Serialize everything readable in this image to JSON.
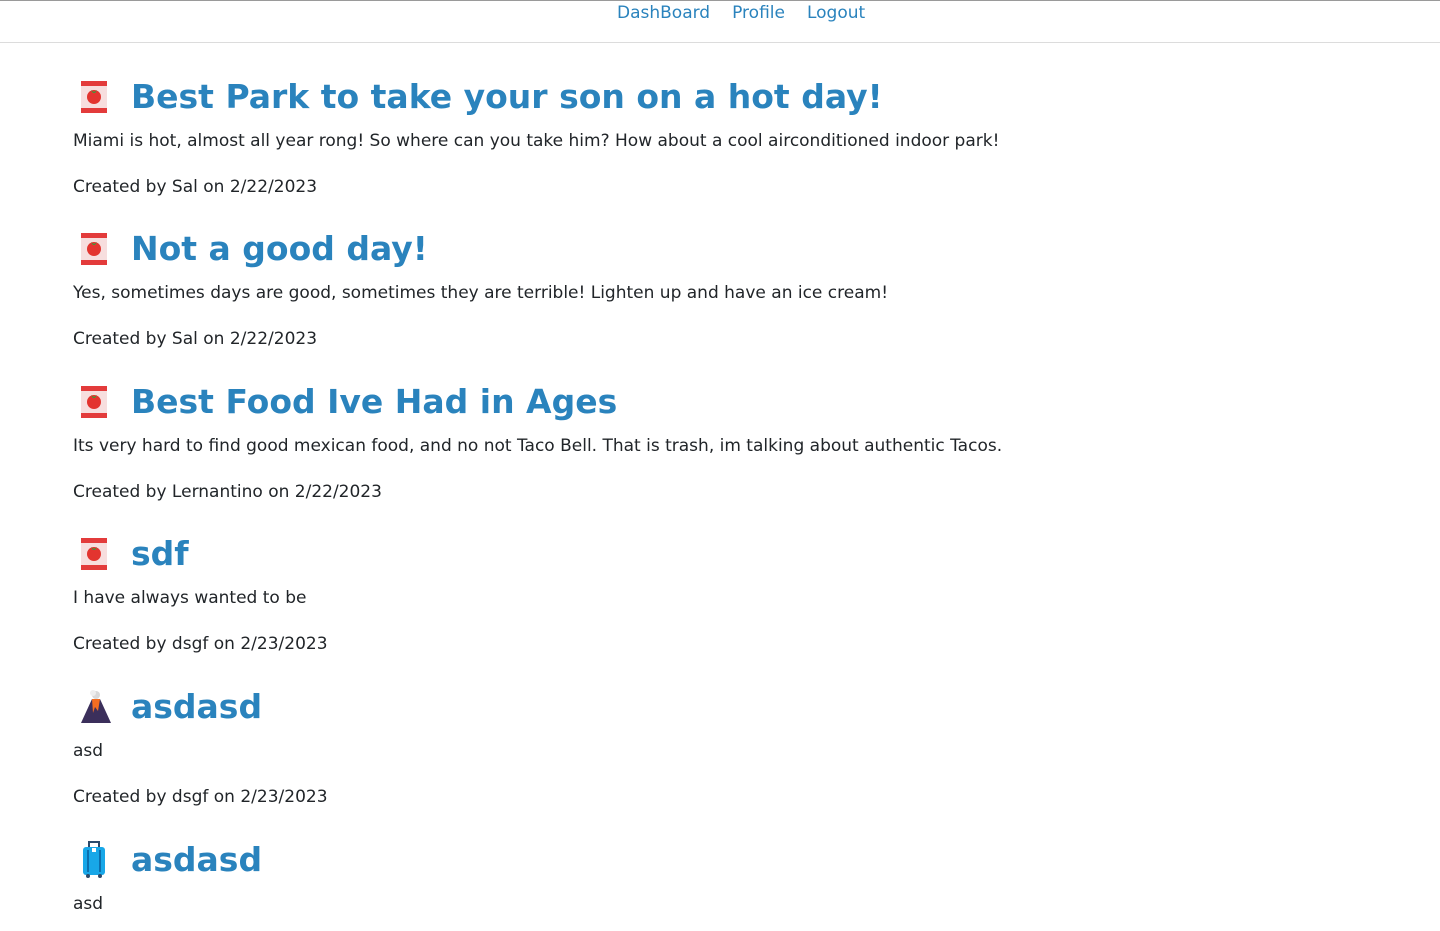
{
  "nav": {
    "items": [
      "DashBoard",
      "Profile",
      "Logout"
    ]
  },
  "posts": [
    {
      "icon": "tomato-can-icon",
      "title": "Best Park to take your son on a hot day!",
      "body": "Miami is hot, almost all year rong! So where can you take him? How about a cool airconditioned indoor park!",
      "meta": "Created by Sal on 2/22/2023"
    },
    {
      "icon": "tomato-can-icon",
      "title": "Not a good day!",
      "body": "Yes, sometimes days are good, sometimes they are terrible! Lighten up and have an ice cream!",
      "meta": "Created by Sal on 2/22/2023"
    },
    {
      "icon": "tomato-can-icon",
      "title": "Best Food Ive Had in Ages",
      "body": "Its very hard to find good mexican food, and no not Taco Bell. That is trash, im talking about authentic Tacos.",
      "meta": "Created by Lernantino on 2/22/2023"
    },
    {
      "icon": "tomato-can-icon",
      "title": "sdf",
      "body": "I have always wanted to be",
      "meta": "Created by dsgf on 2/23/2023"
    },
    {
      "icon": "volcano-icon",
      "title": "asdasd",
      "body": "asd",
      "meta": "Created by dsgf on 2/23/2023"
    },
    {
      "icon": "luggage-icon",
      "title": "asdasd",
      "body": "asd",
      "meta": ""
    }
  ],
  "colors": {
    "link": "#2a83bd",
    "text": "#212529"
  }
}
